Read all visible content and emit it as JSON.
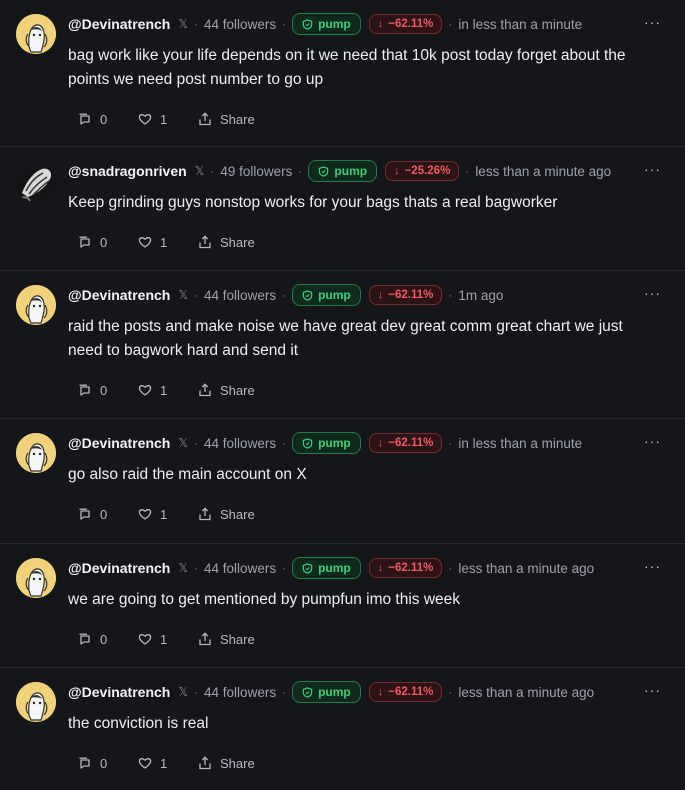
{
  "share_label": "Share",
  "more_label": "···",
  "posts": [
    {
      "username": "@Devinatrench",
      "followers": "44 followers",
      "badge": "pump",
      "change": "−62.11%",
      "time": "in less than a minute",
      "text": "bag work like your life depends on it we need that 10k post today forget about the points we need post number to go up",
      "replies": "0",
      "likes": "1",
      "avatar": "girl"
    },
    {
      "username": "@snadragonriven",
      "followers": "49 followers",
      "badge": "pump",
      "change": "−25.26%",
      "time": "less than a minute ago",
      "text": "Keep grinding guys nonstop works for your bags thats a real bagworker",
      "replies": "0",
      "likes": "1",
      "avatar": "dark"
    },
    {
      "username": "@Devinatrench",
      "followers": "44 followers",
      "badge": "pump",
      "change": "−62.11%",
      "time": "1m ago",
      "text": "raid the posts and make noise we have great dev great comm great chart we just need to bagwork hard and send it",
      "replies": "0",
      "likes": "1",
      "avatar": "girl"
    },
    {
      "username": "@Devinatrench",
      "followers": "44 followers",
      "badge": "pump",
      "change": "−62.11%",
      "time": "in less than a minute",
      "text": "go also raid the main account on X",
      "replies": "0",
      "likes": "1",
      "avatar": "girl"
    },
    {
      "username": "@Devinatrench",
      "followers": "44 followers",
      "badge": "pump",
      "change": "−62.11%",
      "time": "less than a minute ago",
      "text": "we are going to get mentioned by pumpfun imo this week",
      "replies": "0",
      "likes": "1",
      "avatar": "girl"
    },
    {
      "username": "@Devinatrench",
      "followers": "44 followers",
      "badge": "pump",
      "change": "−62.11%",
      "time": "less than a minute ago",
      "text": "the conviction is real",
      "replies": "0",
      "likes": "1",
      "avatar": "girl"
    }
  ]
}
